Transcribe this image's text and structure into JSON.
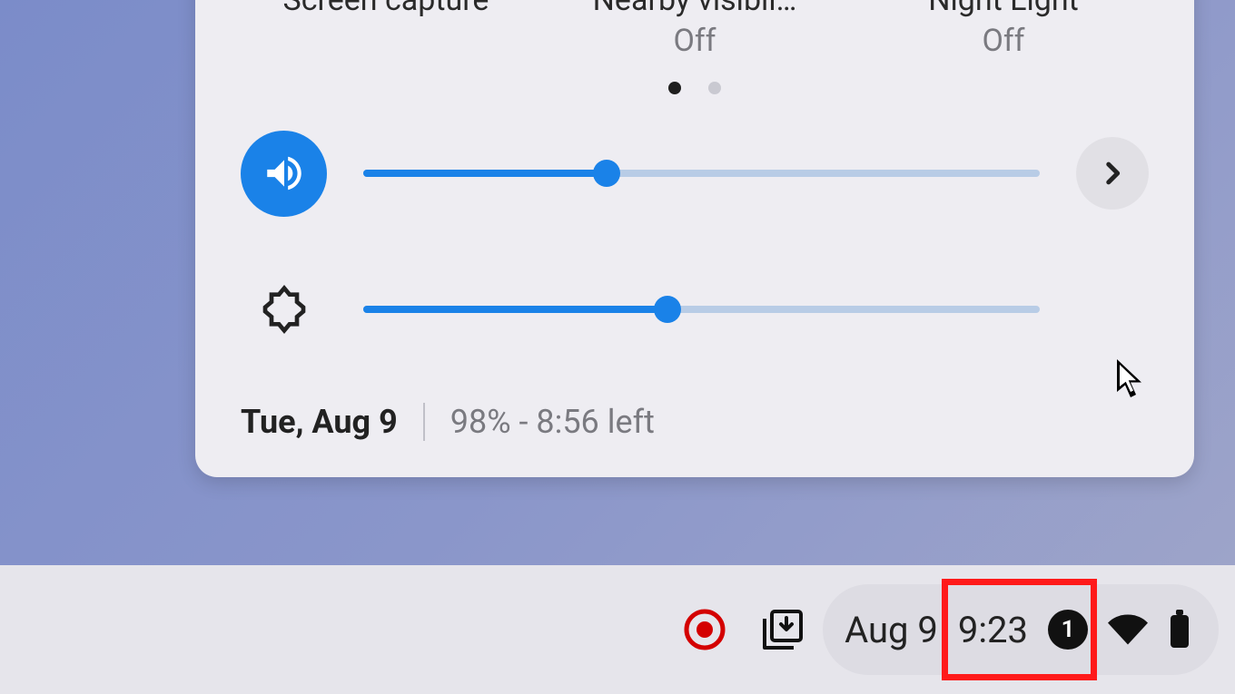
{
  "panel": {
    "toggles": [
      {
        "title": "Screen capture",
        "status": ""
      },
      {
        "title": "Nearby visibil…",
        "status": "Off"
      },
      {
        "title": "Night Light",
        "status": "Off"
      }
    ],
    "pageDots": {
      "count": 2,
      "active": 0
    },
    "volume": {
      "percent": 36
    },
    "brightness": {
      "percent": 45
    },
    "footer": {
      "date": "Tue, Aug 9",
      "battery": "98% - 8:56 left"
    }
  },
  "shelf": {
    "date": "Aug 9",
    "time": "9:23",
    "badge": "1"
  }
}
